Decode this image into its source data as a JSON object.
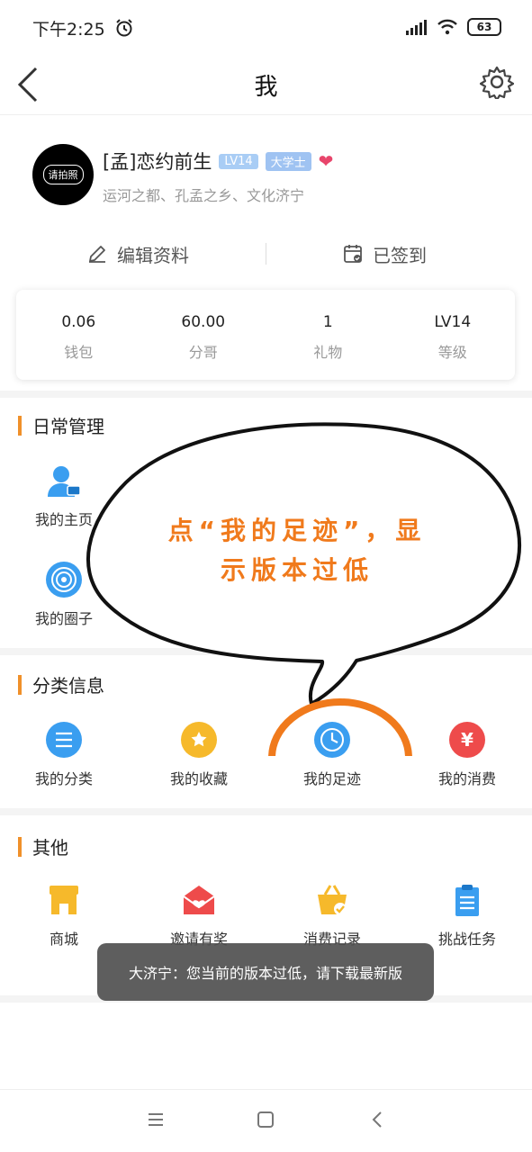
{
  "status_bar": {
    "time": "下午2:25",
    "battery": "63",
    "icons": [
      "alarm-icon",
      "signal-icon",
      "wifi-icon",
      "battery-icon"
    ]
  },
  "nav": {
    "title": "我",
    "back_icon": "chevron-left-icon",
    "settings_icon": "gear-icon"
  },
  "profile": {
    "avatar_text": "请拍照",
    "name": "[孟]恋约前生",
    "level_tag": "LV14",
    "edu_tag": "大学士",
    "desc": "运河之都、孔孟之乡、文化济宁"
  },
  "actions": {
    "edit_label": "编辑资料",
    "sign_label": "已签到"
  },
  "stats": [
    {
      "value": "0.06",
      "label": "钱包"
    },
    {
      "value": "60.00",
      "label": "分哥"
    },
    {
      "value": "1",
      "label": "礼物"
    },
    {
      "value": "LV14",
      "label": "等级"
    }
  ],
  "sections": {
    "daily": {
      "title": "日常管理",
      "items": [
        {
          "label": "我的主页",
          "icon": "user-card-icon"
        },
        {
          "label": "我的圈子",
          "icon": "target-circle-icon"
        }
      ]
    },
    "category": {
      "title": "分类信息",
      "items": [
        {
          "label": "我的分类",
          "icon": "list-icon"
        },
        {
          "label": "我的收藏",
          "icon": "star-box-icon"
        },
        {
          "label": "我的足迹",
          "icon": "clock-icon"
        },
        {
          "label": "我的消费",
          "icon": "yen-icon"
        }
      ]
    },
    "other": {
      "title": "其他",
      "items": [
        {
          "label": "商城",
          "icon": "shop-icon"
        },
        {
          "label": "邀请有奖",
          "icon": "envelope-heart-icon"
        },
        {
          "label": "消费记录",
          "icon": "basket-icon"
        },
        {
          "label": "挑战任务",
          "icon": "clipboard-icon"
        }
      ]
    }
  },
  "annotation": {
    "text_line1": "点“我的足迹”，显",
    "text_line2": "示版本过低",
    "accent": "#f07a1c"
  },
  "toast": {
    "text": "大济宁：您当前的版本过低，请下载最新版"
  },
  "colors": {
    "accent_orange": "#f0902a",
    "blue": "#3a9ef0",
    "yellow": "#f6b92b",
    "red": "#ee4b4b"
  }
}
